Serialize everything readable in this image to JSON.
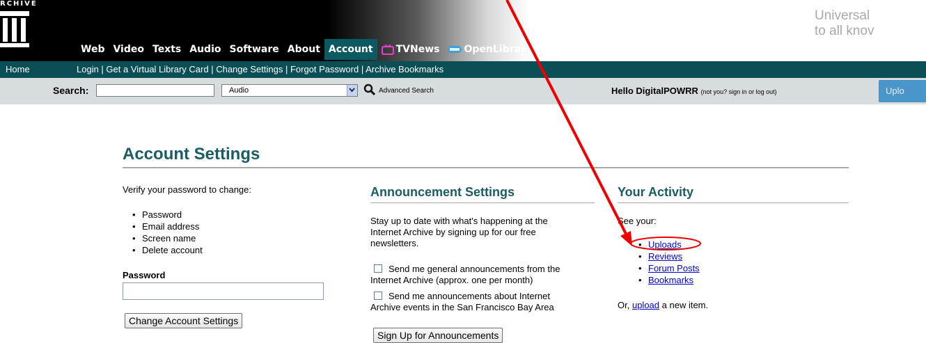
{
  "header": {
    "logo_text": "RCHIVE",
    "tagline_lines": [
      "Universal",
      "to all knov"
    ],
    "nav": [
      {
        "label": "Web"
      },
      {
        "label": "Video"
      },
      {
        "label": "Texts"
      },
      {
        "label": "Audio"
      },
      {
        "label": "Software"
      },
      {
        "label": "About"
      },
      {
        "label": "Account",
        "active": true
      },
      {
        "label": "TVNews",
        "icon": "tv-icon"
      },
      {
        "label": "OpenLibrary",
        "icon": "open-library-icon"
      }
    ]
  },
  "subnav": {
    "home": "Home",
    "links": [
      "Login",
      "Get a Virtual Library Card",
      "Change Settings",
      "Forgot Password",
      "Archive Bookmarks"
    ]
  },
  "search": {
    "label": "Search:",
    "input_value": "",
    "selected_option": "Audio",
    "advanced_label": "Advanced Search",
    "hello_text": "Hello DigitalPOWRR",
    "hello_sub": "(not you? sign in or log out)",
    "upload_label": "Uplo"
  },
  "main": {
    "title": "Account Settings",
    "verify": {
      "intro": "Verify your password to change:",
      "items": [
        "Password",
        "Email address",
        "Screen name",
        "Delete account"
      ],
      "password_label": "Password",
      "password_value": "",
      "button_label": "Change Account Settings"
    },
    "announcements": {
      "heading": "Announcement Settings",
      "intro_lines": [
        "Stay up to date with what's happening at the",
        "Internet Archive by signing up for our free",
        "newsletters."
      ],
      "option1_lines": [
        "Send me general announcements from the",
        "Internet Archive (approx. one per month)"
      ],
      "option2_lines": [
        "Send me announcements about Internet",
        "Archive events in the San Francisco Bay Area"
      ],
      "button_label": "Sign Up for Announcements"
    },
    "activity": {
      "heading": "Your Activity",
      "intro": "See your:",
      "links": [
        "Uploads",
        "Reviews",
        "Forum Posts",
        "Bookmarks"
      ],
      "footer_prefix": "Or,",
      "footer_link": "upload",
      "footer_suffix": "a new item."
    }
  },
  "colors": {
    "accent": "#1a5c63",
    "subnav_bg": "#0b4f56",
    "search_bg": "#d7dcde",
    "annotation": "#ee0000"
  }
}
